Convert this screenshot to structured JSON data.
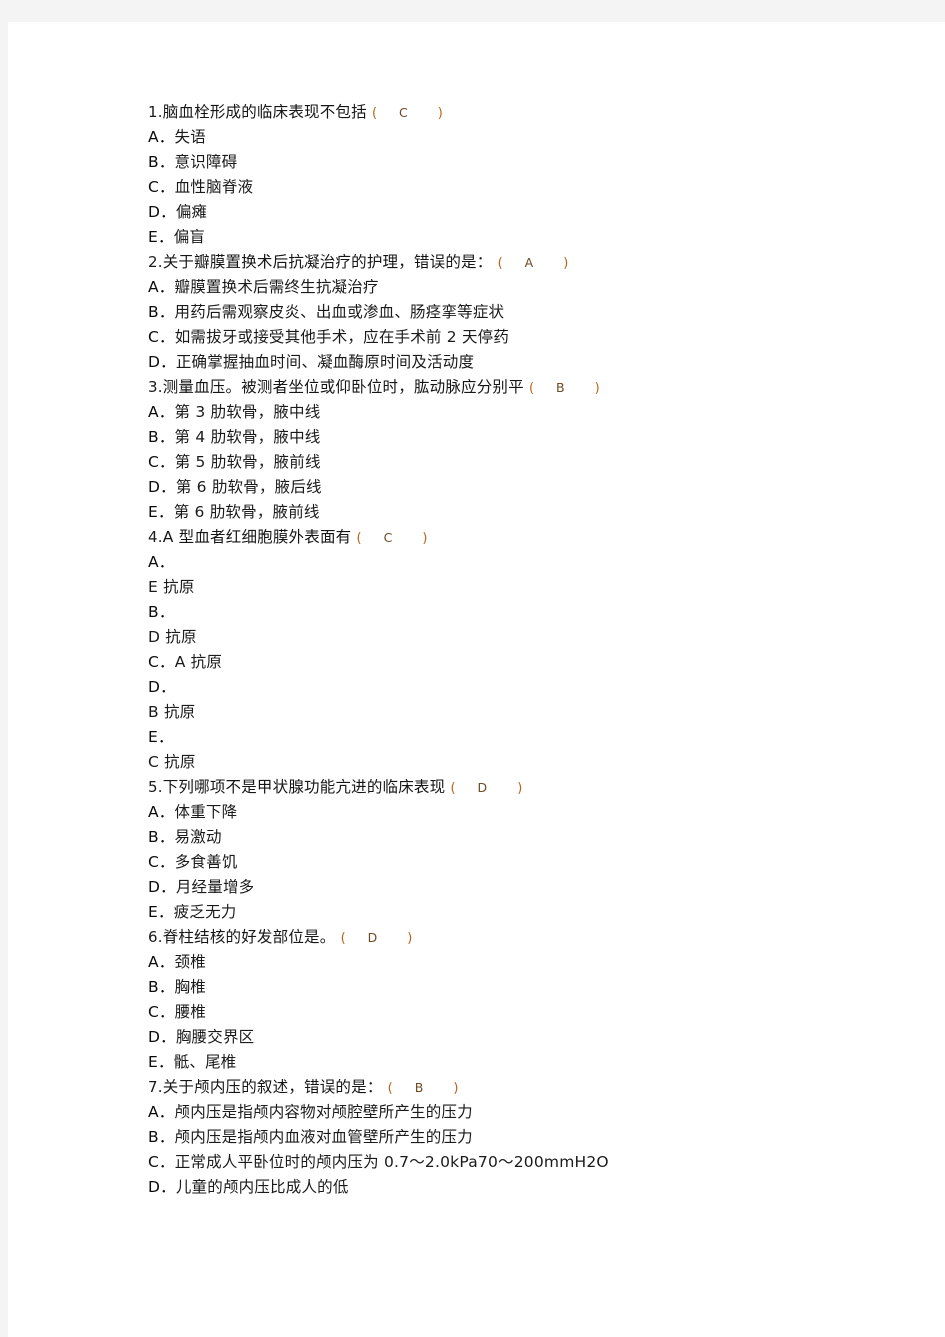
{
  "document": {
    "page_background": "#ffffff",
    "canvas_background": "#f4f4f5",
    "text_color": "#1a1a1a",
    "answer_mark_color": "#b5651d",
    "questions": [
      {
        "number": "1.",
        "stem": "脑血栓形成的临床表现不包括",
        "answer": "C",
        "has_bracket": true,
        "options": [
          {
            "label": "A．",
            "text": "失语"
          },
          {
            "label": "B．",
            "text": "意识障碍"
          },
          {
            "label": "C．",
            "text": "血性脑脊液"
          },
          {
            "label": "D．",
            "text": "偏瘫"
          },
          {
            "label": "E．",
            "text": "偏盲"
          }
        ]
      },
      {
        "number": "2.",
        "stem": "关于瓣膜置换术后抗凝治疗的护理，错误的是：",
        "answer": "A",
        "has_bracket": true,
        "options": [
          {
            "label": "A．",
            "text": "瓣膜置换术后需终生抗凝治疗"
          },
          {
            "label": "B．",
            "text": "用药后需观察皮炎、出血或渗血、肠痉挛等症状"
          },
          {
            "label": "C．",
            "text": "如需拔牙或接受其他手术，应在手术前 2 天停药"
          },
          {
            "label": "D．",
            "text": "正确掌握抽血时间、凝血酶原时间及活动度"
          }
        ]
      },
      {
        "number": "3.",
        "stem": "测量血压。被测者坐位或仰卧位时，肱动脉应分别平",
        "answer": "B",
        "has_bracket": true,
        "options": [
          {
            "label": "A．",
            "text": "第 3 肋软骨，腋中线"
          },
          {
            "label": "B．",
            "text": "第 4 肋软骨，腋中线"
          },
          {
            "label": "C．",
            "text": "第 5 肋软骨，腋前线"
          },
          {
            "label": "D．",
            "text": "第 6 肋软骨，腋后线"
          },
          {
            "label": "E．",
            "text": "第 6 肋软骨，腋前线"
          }
        ]
      },
      {
        "number": "4.",
        "stem": "A 型血者红细胞膜外表面有",
        "answer": "C",
        "has_bracket": true,
        "options": [
          {
            "label": "A．",
            "text": ""
          },
          {
            "label": "",
            "text": "E 抗原"
          },
          {
            "label": "B．",
            "text": ""
          },
          {
            "label": "",
            "text": "D 抗原"
          },
          {
            "label": "C．",
            "text": "A 抗原"
          },
          {
            "label": "D．",
            "text": ""
          },
          {
            "label": "",
            "text": "B 抗原"
          },
          {
            "label": "E．",
            "text": ""
          },
          {
            "label": "",
            "text": "C 抗原"
          }
        ]
      },
      {
        "number": "5.",
        "stem": "下列哪项不是甲状腺功能亢进的临床表现",
        "answer": "D",
        "has_bracket": true,
        "options": [
          {
            "label": "A．",
            "text": "体重下降"
          },
          {
            "label": "B．",
            "text": "易激动"
          },
          {
            "label": "C．",
            "text": "多食善饥"
          },
          {
            "label": "D．",
            "text": "月经量增多"
          },
          {
            "label": "E．",
            "text": "疲乏无力"
          }
        ]
      },
      {
        "number": "6.",
        "stem": "脊柱结核的好发部位是。",
        "answer": "D",
        "has_bracket": true,
        "options": [
          {
            "label": "A．",
            "text": "颈椎"
          },
          {
            "label": "B．",
            "text": "胸椎"
          },
          {
            "label": "C．",
            "text": "腰椎"
          },
          {
            "label": "D．",
            "text": "胸腰交界区"
          },
          {
            "label": "E．",
            "text": "骶、尾椎"
          }
        ]
      },
      {
        "number": "7.",
        "stem": "关于颅内压的叙述，错误的是：",
        "answer": "B",
        "has_bracket": true,
        "options": [
          {
            "label": "A．",
            "text": "颅内压是指颅内容物对颅腔壁所产生的压力"
          },
          {
            "label": "B．",
            "text": "颅内压是指颅内血液对血管壁所产生的压力"
          },
          {
            "label": "C．",
            "text": "正常成人平卧位时的颅内压为 0.7～2.0kPa70～200mmH2O"
          },
          {
            "label": "D．",
            "text": "儿童的颅内压比成人的低"
          }
        ]
      }
    ]
  }
}
